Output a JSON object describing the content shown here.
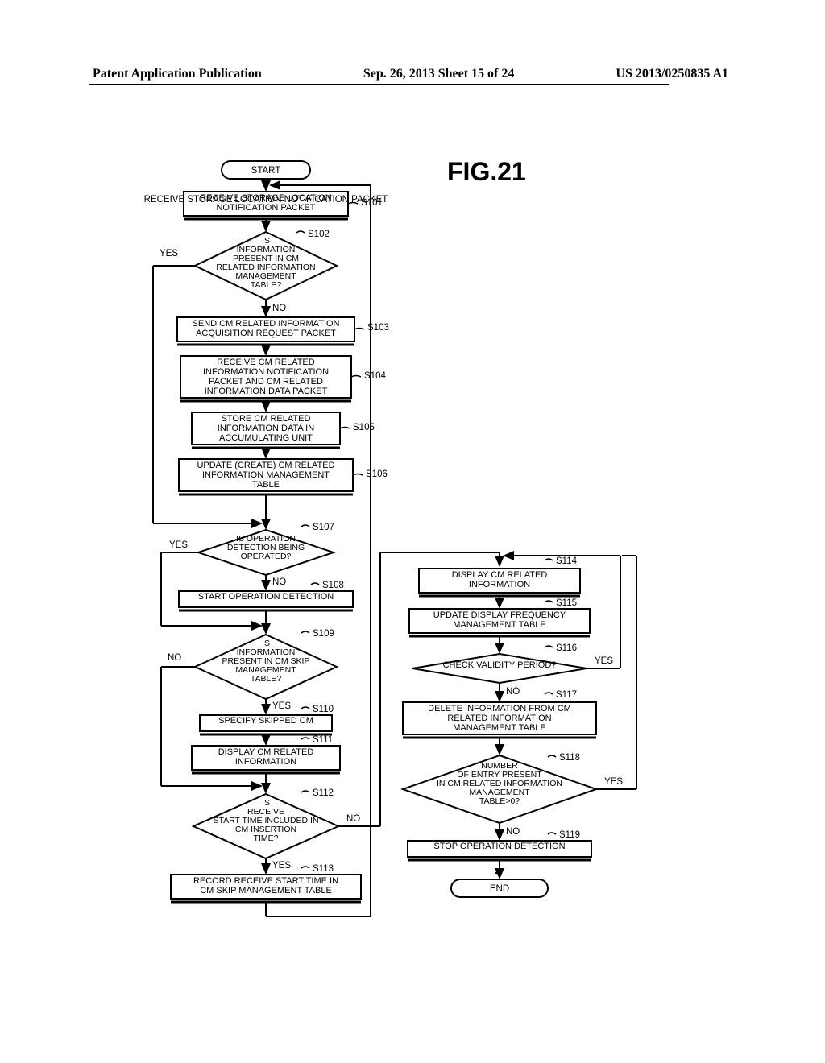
{
  "header": {
    "left": "Patent Application Publication",
    "center": "Sep. 26, 2013  Sheet 15 of 24",
    "right": "US 2013/0250835 A1"
  },
  "figure_label": "FIG.21",
  "steps": {
    "start": "START",
    "s101": "RECEIVE STORAGE LOCATION NOTIFICATION PACKET",
    "s102": "IS INFORMATION PRESENT IN CM RELATED INFORMATION MANAGEMENT TABLE?",
    "s103": "SEND CM RELATED INFORMATION ACQUISITION REQUEST PACKET",
    "s104": "RECEIVE CM RELATED INFORMATION NOTIFICATION PACKET AND CM RELATED INFORMATION DATA PACKET",
    "s105": "STORE CM RELATED INFORMATION DATA IN ACCUMULATING UNIT",
    "s106": "UPDATE (CREATE) CM RELATED INFORMATION MANAGEMENT TABLE",
    "s107": "IS OPERATION DETECTION BEING OPERATED?",
    "s108": "START OPERATION DETECTION",
    "s109": "IS INFORMATION PRESENT IN CM SKIP MANAGEMENT TABLE?",
    "s110": "SPECIFY SKIPPED CM",
    "s111": "DISPLAY CM RELATED INFORMATION",
    "s112": "IS RECEIVE START TIME INCLUDED IN CM INSERTION TIME?",
    "s113": "RECORD RECEIVE START TIME IN CM SKIP MANAGEMENT TABLE",
    "s114": "DISPLAY CM RELATED INFORMATION",
    "s115": "UPDATE DISPLAY FREQUENCY MANAGEMENT TABLE",
    "s116": "CHECK VALIDITY PERIOD?",
    "s117": "DELETE INFORMATION FROM CM RELATED INFORMATION MANAGEMENT TABLE",
    "s118": "NUMBER OF ENTRY PRESENT IN CM RELATED INFORMATION MANAGEMENT TABLE>0?",
    "s119": "STOP OPERATION DETECTION",
    "end": "END"
  },
  "labels": {
    "s101": "S101",
    "s102": "S102",
    "s103": "S103",
    "s104": "S104",
    "s105": "S105",
    "s106": "S106",
    "s107": "S107",
    "s108": "S108",
    "s109": "S109",
    "s110": "S110",
    "s111": "S111",
    "s112": "S112",
    "s113": "S113",
    "s114": "S114",
    "s115": "S115",
    "s116": "S116",
    "s117": "S117",
    "s118": "S118",
    "s119": "S119"
  },
  "branches": {
    "yes": "YES",
    "no": "NO"
  },
  "chart_data": {
    "type": "flowchart",
    "title": "FIG.21",
    "nodes": [
      {
        "id": "start",
        "type": "terminator",
        "text": "START"
      },
      {
        "id": "S101",
        "type": "process",
        "text": "RECEIVE STORAGE LOCATION NOTIFICATION PACKET"
      },
      {
        "id": "S102",
        "type": "decision",
        "text": "IS INFORMATION PRESENT IN CM RELATED INFORMATION MANAGEMENT TABLE?"
      },
      {
        "id": "S103",
        "type": "process",
        "text": "SEND CM RELATED INFORMATION ACQUISITION REQUEST PACKET"
      },
      {
        "id": "S104",
        "type": "process",
        "text": "RECEIVE CM RELATED INFORMATION NOTIFICATION PACKET AND CM RELATED INFORMATION DATA PACKET"
      },
      {
        "id": "S105",
        "type": "process",
        "text": "STORE CM RELATED INFORMATION DATA IN ACCUMULATING UNIT"
      },
      {
        "id": "S106",
        "type": "process",
        "text": "UPDATE (CREATE) CM RELATED INFORMATION MANAGEMENT TABLE"
      },
      {
        "id": "S107",
        "type": "decision",
        "text": "IS OPERATION DETECTION BEING OPERATED?"
      },
      {
        "id": "S108",
        "type": "process",
        "text": "START OPERATION DETECTION"
      },
      {
        "id": "S109",
        "type": "decision",
        "text": "IS INFORMATION PRESENT IN CM SKIP MANAGEMENT TABLE?"
      },
      {
        "id": "S110",
        "type": "process",
        "text": "SPECIFY SKIPPED CM"
      },
      {
        "id": "S111",
        "type": "process",
        "text": "DISPLAY CM RELATED INFORMATION"
      },
      {
        "id": "S112",
        "type": "decision",
        "text": "IS RECEIVE START TIME INCLUDED IN CM INSERTION TIME?"
      },
      {
        "id": "S113",
        "type": "process",
        "text": "RECORD RECEIVE START TIME IN CM SKIP MANAGEMENT TABLE"
      },
      {
        "id": "S114",
        "type": "process",
        "text": "DISPLAY CM RELATED INFORMATION"
      },
      {
        "id": "S115",
        "type": "process",
        "text": "UPDATE DISPLAY FREQUENCY MANAGEMENT TABLE"
      },
      {
        "id": "S116",
        "type": "decision",
        "text": "CHECK VALIDITY PERIOD?"
      },
      {
        "id": "S117",
        "type": "process",
        "text": "DELETE INFORMATION FROM CM RELATED INFORMATION MANAGEMENT TABLE"
      },
      {
        "id": "S118",
        "type": "decision",
        "text": "NUMBER OF ENTRY PRESENT IN CM RELATED INFORMATION MANAGEMENT TABLE>0?"
      },
      {
        "id": "S119",
        "type": "process",
        "text": "STOP OPERATION DETECTION"
      },
      {
        "id": "end",
        "type": "terminator",
        "text": "END"
      }
    ],
    "edges": [
      {
        "from": "start",
        "to": "S101"
      },
      {
        "from": "S101",
        "to": "S102"
      },
      {
        "from": "S102",
        "to": "S107",
        "label": "YES"
      },
      {
        "from": "S102",
        "to": "S103",
        "label": "NO"
      },
      {
        "from": "S103",
        "to": "S104"
      },
      {
        "from": "S104",
        "to": "S105"
      },
      {
        "from": "S105",
        "to": "S106"
      },
      {
        "from": "S106",
        "to": "S107"
      },
      {
        "from": "S107",
        "to": "S109",
        "label": "YES"
      },
      {
        "from": "S107",
        "to": "S108",
        "label": "NO"
      },
      {
        "from": "S108",
        "to": "S109"
      },
      {
        "from": "S109",
        "to": "S112",
        "label": "NO"
      },
      {
        "from": "S109",
        "to": "S110",
        "label": "YES"
      },
      {
        "from": "S110",
        "to": "S111"
      },
      {
        "from": "S111",
        "to": "S112"
      },
      {
        "from": "S112",
        "to": "S114",
        "label": "NO"
      },
      {
        "from": "S112",
        "to": "S113",
        "label": "YES"
      },
      {
        "from": "S113",
        "to": "S101"
      },
      {
        "from": "S114",
        "to": "S115"
      },
      {
        "from": "S115",
        "to": "S116"
      },
      {
        "from": "S116",
        "to": "S114",
        "label": "YES"
      },
      {
        "from": "S116",
        "to": "S117",
        "label": "NO"
      },
      {
        "from": "S117",
        "to": "S118"
      },
      {
        "from": "S118",
        "to": "S114",
        "label": "YES"
      },
      {
        "from": "S118",
        "to": "S119",
        "label": "NO"
      },
      {
        "from": "S119",
        "to": "end"
      }
    ]
  }
}
